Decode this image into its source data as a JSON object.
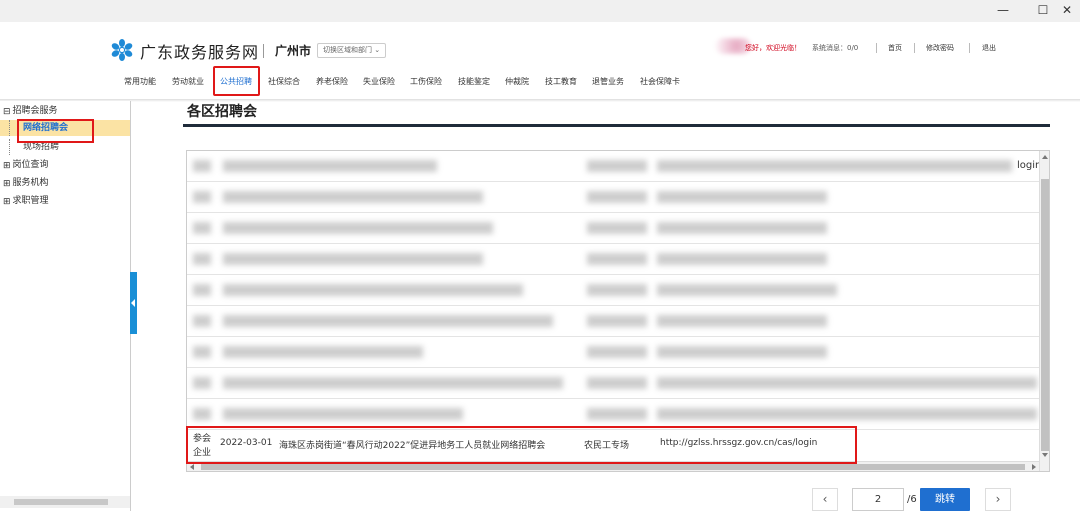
{
  "window": {
    "minimize": "—",
    "maximize": "☐",
    "close": "✕"
  },
  "header": {
    "site_title": "广东政务服务网",
    "city": "广州市",
    "region_select": "切换区域和部门",
    "greeting": "您好，欢迎光临！",
    "system_message": "系统消息：0/0",
    "home": "首页",
    "change_password": "修改密码",
    "logout": "退出"
  },
  "nav": {
    "items": [
      {
        "label": "常用功能"
      },
      {
        "label": "劳动就业"
      },
      {
        "label": "公共招聘"
      },
      {
        "label": "社保综合"
      },
      {
        "label": "养老保险"
      },
      {
        "label": "失业保险"
      },
      {
        "label": "工伤保险"
      },
      {
        "label": "技能鉴定"
      },
      {
        "label": "仲裁院"
      },
      {
        "label": "技工教育"
      },
      {
        "label": "退管业务"
      },
      {
        "label": "社会保障卡"
      }
    ],
    "active_index": 2
  },
  "sidebar": {
    "items": [
      {
        "label": "招聘会服务",
        "toggle": "⊟"
      },
      {
        "label": "网络招聘会"
      },
      {
        "label": "现场招聘"
      },
      {
        "label": "岗位查询",
        "toggle": "⊞"
      },
      {
        "label": "服务机构",
        "toggle": "⊞"
      },
      {
        "label": "求职管理",
        "toggle": "⊞"
      }
    ]
  },
  "content": {
    "title": "各区招聘会",
    "visible_fragment": "login",
    "last_row": {
      "tag_line1": "参会",
      "tag_line2": "企业",
      "date": "2022-03-01",
      "title": "海珠区赤岗街道“春风行动2022”促进异地务工人员就业网络招聘会",
      "type": "农民工专场",
      "url": "http://gzlss.hrssgz.gov.cn/cas/login"
    }
  },
  "pager": {
    "prev": "‹",
    "next": "›",
    "current_page": "2",
    "total": "/6",
    "jump": "跳转"
  },
  "colors": {
    "accent": "#1f6fd0",
    "highlight": "#e01818",
    "selected_bg": "#fbe3a4",
    "collapse_tab": "#1a8fd6"
  }
}
